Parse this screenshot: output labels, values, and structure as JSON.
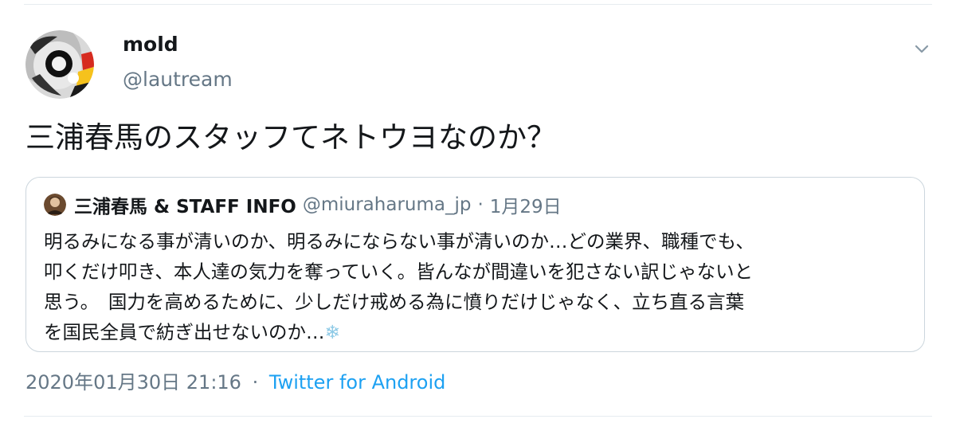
{
  "author": {
    "display_name": "mold",
    "handle": "@lautream"
  },
  "tweet": {
    "text": "三浦春馬のスタッフてネトウヨなのか？"
  },
  "quoted_tweet": {
    "name": "三浦春馬 & STAFF INFO",
    "handle": "@miuraharuma_jp",
    "separator": "·",
    "date": "1月29日",
    "lines": [
      "明るみになる事が清いのか、明るみにならない事が清いのか…どの業界、職種でも、",
      "叩くだけ叩き、本人達の気力を奪っていく。皆んなが間違いを犯さない訳じゃないと",
      "思う。　国力を高めるために、少しだけ戒める為に憤りだけじゃなく、立ち直る言葉",
      "を国民全員で紡ぎ出せないのか…"
    ],
    "emoji": "❄"
  },
  "footer": {
    "timestamp": "2020年01月30日 21:16",
    "separator": "·",
    "source": "Twitter for Android"
  },
  "colors": {
    "text": "#14171a",
    "secondary": "#657786",
    "link": "#1da1f2",
    "border": "#ccd6dd"
  },
  "icons": {
    "menu": "chevron-down-icon",
    "emoji": "snowflake-emoji"
  }
}
